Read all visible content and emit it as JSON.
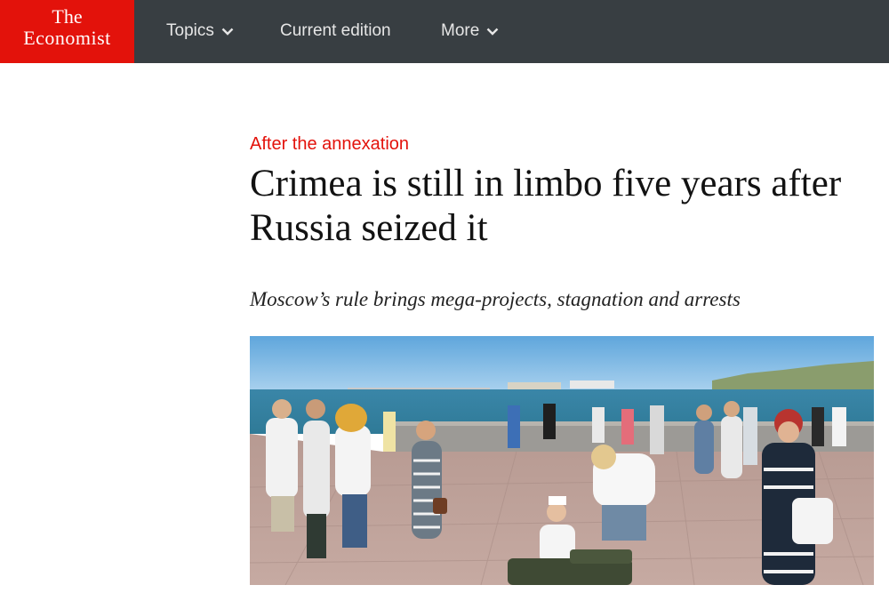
{
  "brand": {
    "line1": "The",
    "line2": "Economist",
    "color": "#e3120b"
  },
  "nav": {
    "background": "#383e42",
    "items": [
      {
        "label": "Topics",
        "has_dropdown": true,
        "icon": "chevron-down-icon"
      },
      {
        "label": "Current edition",
        "has_dropdown": false
      },
      {
        "label": "More",
        "has_dropdown": true,
        "icon": "chevron-down-icon"
      }
    ]
  },
  "article": {
    "kicker": "After the annexation",
    "headline": "Crimea is still in limbo five years after Russia seized it",
    "subheadline": "Moscow’s rule brings mega-projects, stagnation and arrests"
  }
}
